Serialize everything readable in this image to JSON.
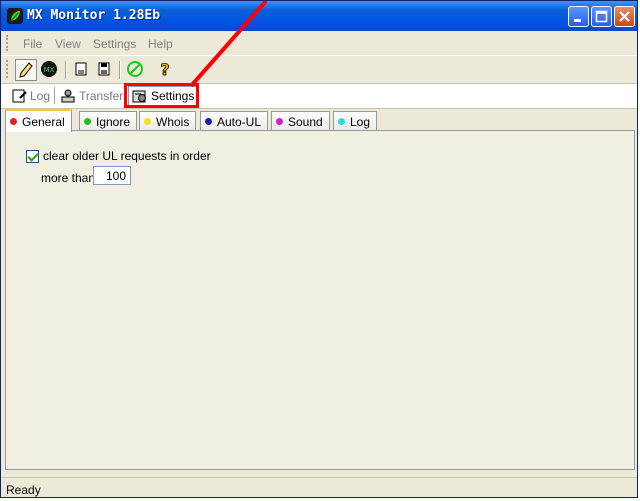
{
  "window": {
    "title": "MX Monitor 1.28Eb"
  },
  "menu": [
    "File",
    "View",
    "Settings",
    "Help"
  ],
  "toolbar": {
    "items": [
      "pencil-icon",
      "mx-icon",
      "page-icon",
      "save-icon",
      "stop-icon",
      "help-icon"
    ]
  },
  "view_tabs": [
    {
      "label": "Log",
      "icon": "log-icon",
      "active": false
    },
    {
      "label": "Transfer",
      "icon": "transfer-icon",
      "active": false
    },
    {
      "label": "Settings",
      "icon": "settings-icon",
      "active": true
    }
  ],
  "settings_tabs": [
    {
      "label": "General",
      "color": "#e02020",
      "active": true
    },
    {
      "label": "Ignore",
      "color": "#20c020",
      "active": false
    },
    {
      "label": "Whois",
      "color": "#f0e020",
      "active": false
    },
    {
      "label": "Auto-UL",
      "color": "#1020a0",
      "active": false
    },
    {
      "label": "Sound",
      "color": "#d020d0",
      "active": false
    },
    {
      "label": "Log",
      "color": "#20e0f0",
      "active": false
    }
  ],
  "general": {
    "clear_checkbox_label": "clear older UL requests in order",
    "clear_checked": true,
    "more_than_label": "more than",
    "more_than_value": "100"
  },
  "status": {
    "text": "Ready"
  },
  "colors": {
    "titlebar": "#0054e3",
    "highlight": "#ff0000",
    "active_tab_accent": "#ffc83c"
  }
}
